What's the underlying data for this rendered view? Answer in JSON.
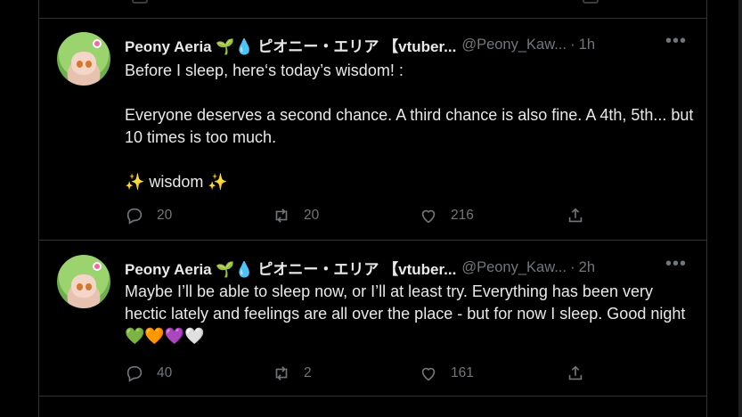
{
  "tweets": [
    {
      "name": "Peony Aeria 🌱💧 ピオニー・エリア 【vtuber...",
      "handle": "@Peony_Kaw...",
      "time": "1h",
      "text": "Before I sleep, here‘s today’s wisdom! :\n\nEveryone deserves a second chance. A third chance is also fine. A 4th, 5th... but 10 times is too much.\n\n✨ wisdom ✨",
      "replies": "20",
      "reposts": "20",
      "likes": "216"
    },
    {
      "name": "Peony Aeria 🌱💧 ピオニー・エリア 【vtuber...",
      "handle": "@Peony_Kaw...",
      "time": "2h",
      "text": "Maybe I’ll be able to sleep now, or I’ll at least try. Everything has been very hectic lately and feelings are all over the place - but for now I sleep. Good night 💚🧡💜🤍",
      "replies": "40",
      "reposts": "2",
      "likes": "161"
    }
  ],
  "icons": {
    "reply": "reply-icon",
    "repost": "repost-icon",
    "like": "heart-icon",
    "share": "share-icon",
    "more": "more-icon"
  }
}
